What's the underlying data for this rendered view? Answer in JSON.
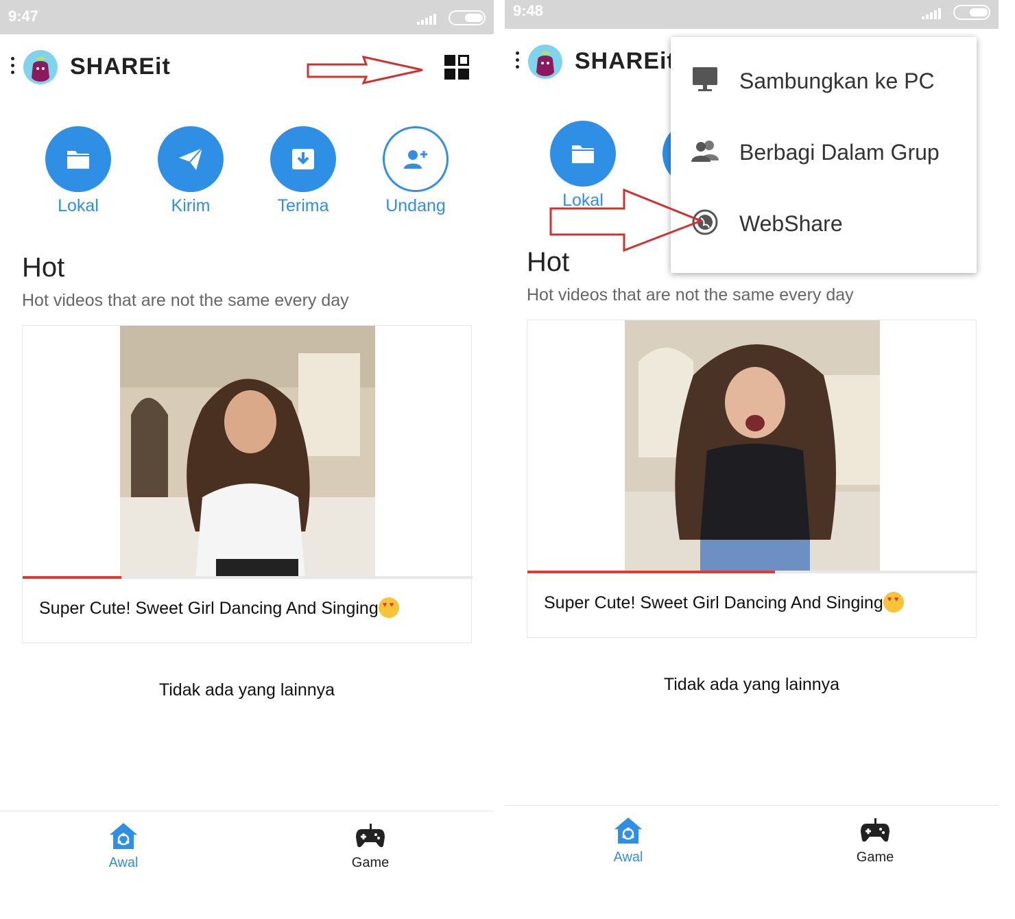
{
  "screens": [
    {
      "status_time": "9:47",
      "app": {
        "title": "SHAREit"
      },
      "actions": [
        {
          "label": "Lokal",
          "icon": "folder-icon"
        },
        {
          "label": "Kirim",
          "icon": "send-icon"
        },
        {
          "label": "Terima",
          "icon": "receive-icon"
        },
        {
          "label": "Undang",
          "icon": "add-user-icon"
        }
      ],
      "hot": {
        "title": "Hot",
        "subtitle": "Hot videos that are not the same every day",
        "video_title": "Super Cute! Sweet Girl Dancing And Singing",
        "progress": 0.22
      },
      "end_note": "Tidak ada yang lainnya",
      "bottom_nav": [
        {
          "label": "Awal",
          "icon": "home-share-icon",
          "active": true
        },
        {
          "label": "Game",
          "icon": "gamepad-icon",
          "active": false
        }
      ]
    },
    {
      "status_time": "9:48",
      "app": {
        "title": "SHAREit"
      },
      "actions": [
        {
          "label": "Lokal",
          "icon": "folder-icon"
        }
      ],
      "popup_menu": [
        {
          "label": "Sambungkan ke PC",
          "icon": "monitor-icon"
        },
        {
          "label": "Berbagi Dalam Grup",
          "icon": "group-icon"
        },
        {
          "label": "WebShare",
          "icon": "webshare-icon"
        }
      ],
      "hot": {
        "title": "Hot",
        "subtitle": "Hot videos that are not the same every day",
        "video_title": "Super Cute! Sweet Girl Dancing And Singing",
        "progress": 0.55
      },
      "end_note": "Tidak ada yang lainnya",
      "bottom_nav": [
        {
          "label": "Awal",
          "icon": "home-share-icon",
          "active": true
        },
        {
          "label": "Game",
          "icon": "gamepad-icon",
          "active": false
        }
      ]
    }
  ],
  "colors": {
    "accent": "#2f8fe5",
    "progress": "#e53935",
    "annotation_arrow": "#d32f2f",
    "status_bar": "#d6d6d6"
  }
}
